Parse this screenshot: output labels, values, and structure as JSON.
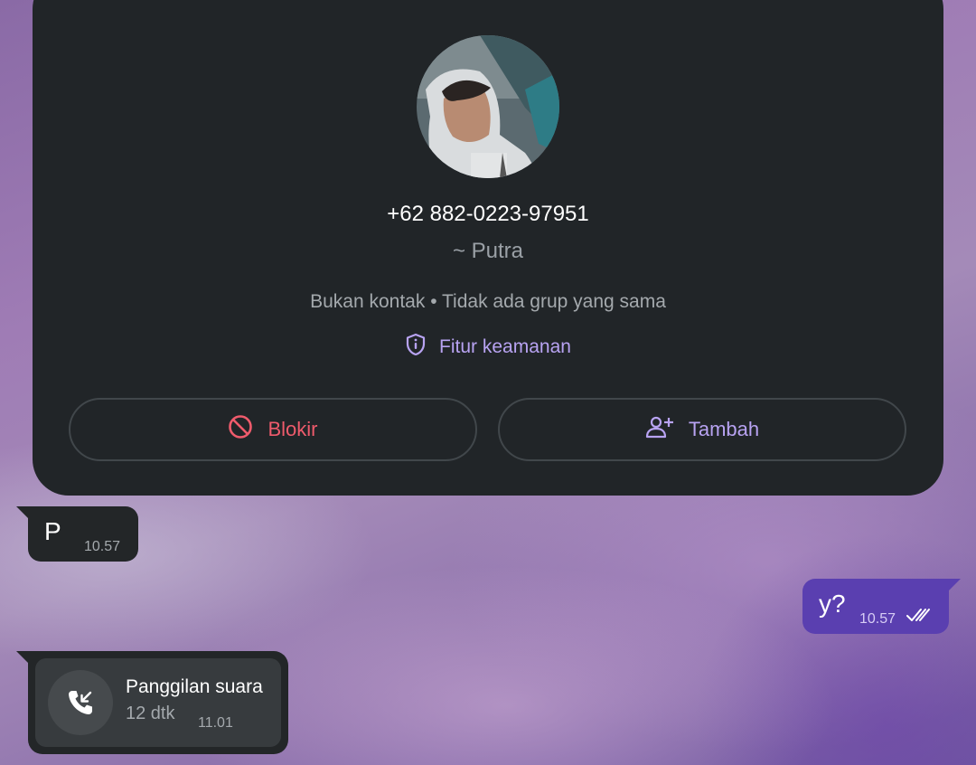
{
  "contact_card": {
    "phone_number": "+62 882-0223-97951",
    "push_name": "~ Putra",
    "info_line": "Bukan kontak • Tidak ada grup yang sama",
    "security_label": "Fitur keamanan",
    "block_button_label": "Blokir",
    "add_button_label": "Tambah"
  },
  "messages": [
    {
      "direction": "incoming",
      "text": "P",
      "time": "10.57"
    },
    {
      "direction": "outgoing",
      "text": "y?",
      "time": "10.57",
      "status": "read"
    }
  ],
  "call_log": {
    "title": "Panggilan suara",
    "duration": "12 dtk",
    "time": "11.01",
    "icon": "incoming-call-icon"
  },
  "colors": {
    "card_background": "#212528",
    "block_red": "#ef5b6c",
    "accent_purple": "#b8a3f2",
    "outgoing_bubble": "#5a3fb0",
    "incoming_bubble": "#232628"
  }
}
